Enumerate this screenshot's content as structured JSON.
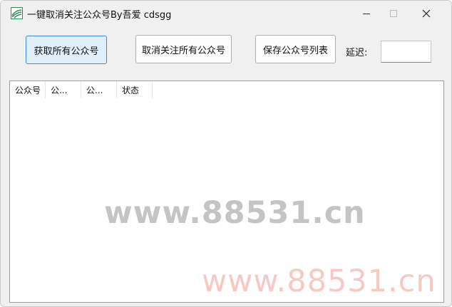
{
  "window": {
    "title": "一键取消关注公众号By吾爱 cdsgg",
    "icon": "app-logo-icon",
    "controls": {
      "minimize": "minimize-icon",
      "maximize": "maximize-icon",
      "close": "✕"
    }
  },
  "toolbar": {
    "fetch_label": "获取所有公众号",
    "unfollow_label": "取消关注所有公众号",
    "save_label": "保存公众号列表",
    "delay_label": "延迟:",
    "delay_value": ""
  },
  "list": {
    "columns": [
      "公众号",
      "公...",
      "公...",
      "状态"
    ],
    "rows": []
  },
  "watermarks": {
    "center": "www.88531.cn",
    "corner": "www.88531.cn"
  },
  "colors": {
    "window_bg": "#f0f0f0",
    "primary_button_bg": "#e1effa",
    "primary_button_border": "#3c8ad7",
    "watermark_gray": "#c4c4c4",
    "watermark_pink": "#f6c9c4",
    "icon_green": "#2f8f5b"
  }
}
